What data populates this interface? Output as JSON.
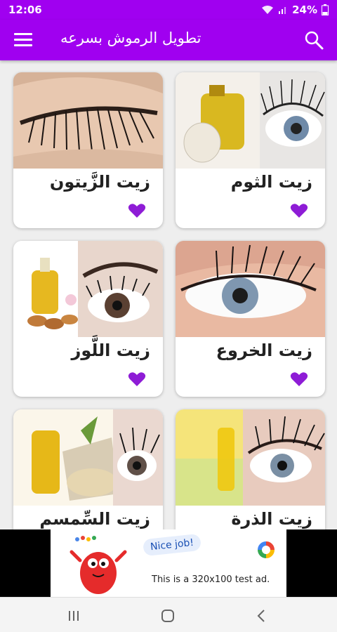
{
  "status": {
    "time": "12:06",
    "battery": "24%"
  },
  "appbar": {
    "title": "تطويل الرموش بسرعه",
    "menu_icon": "menu-icon",
    "search_icon": "search-icon"
  },
  "cards": [
    {
      "label": "زيت الثوم"
    },
    {
      "label": "زيت الزَّيتون"
    },
    {
      "label": "زيت الخروع"
    },
    {
      "label": "زيت اللَّوز"
    },
    {
      "label": "زيت الذرة"
    },
    {
      "label": "زيت السِّمسم"
    }
  ],
  "ad": {
    "bubble": "Nice job!",
    "text": "This is a 320x100 test ad."
  },
  "colors": {
    "primary": "#a000f0",
    "heart": "#8e1cd6"
  }
}
